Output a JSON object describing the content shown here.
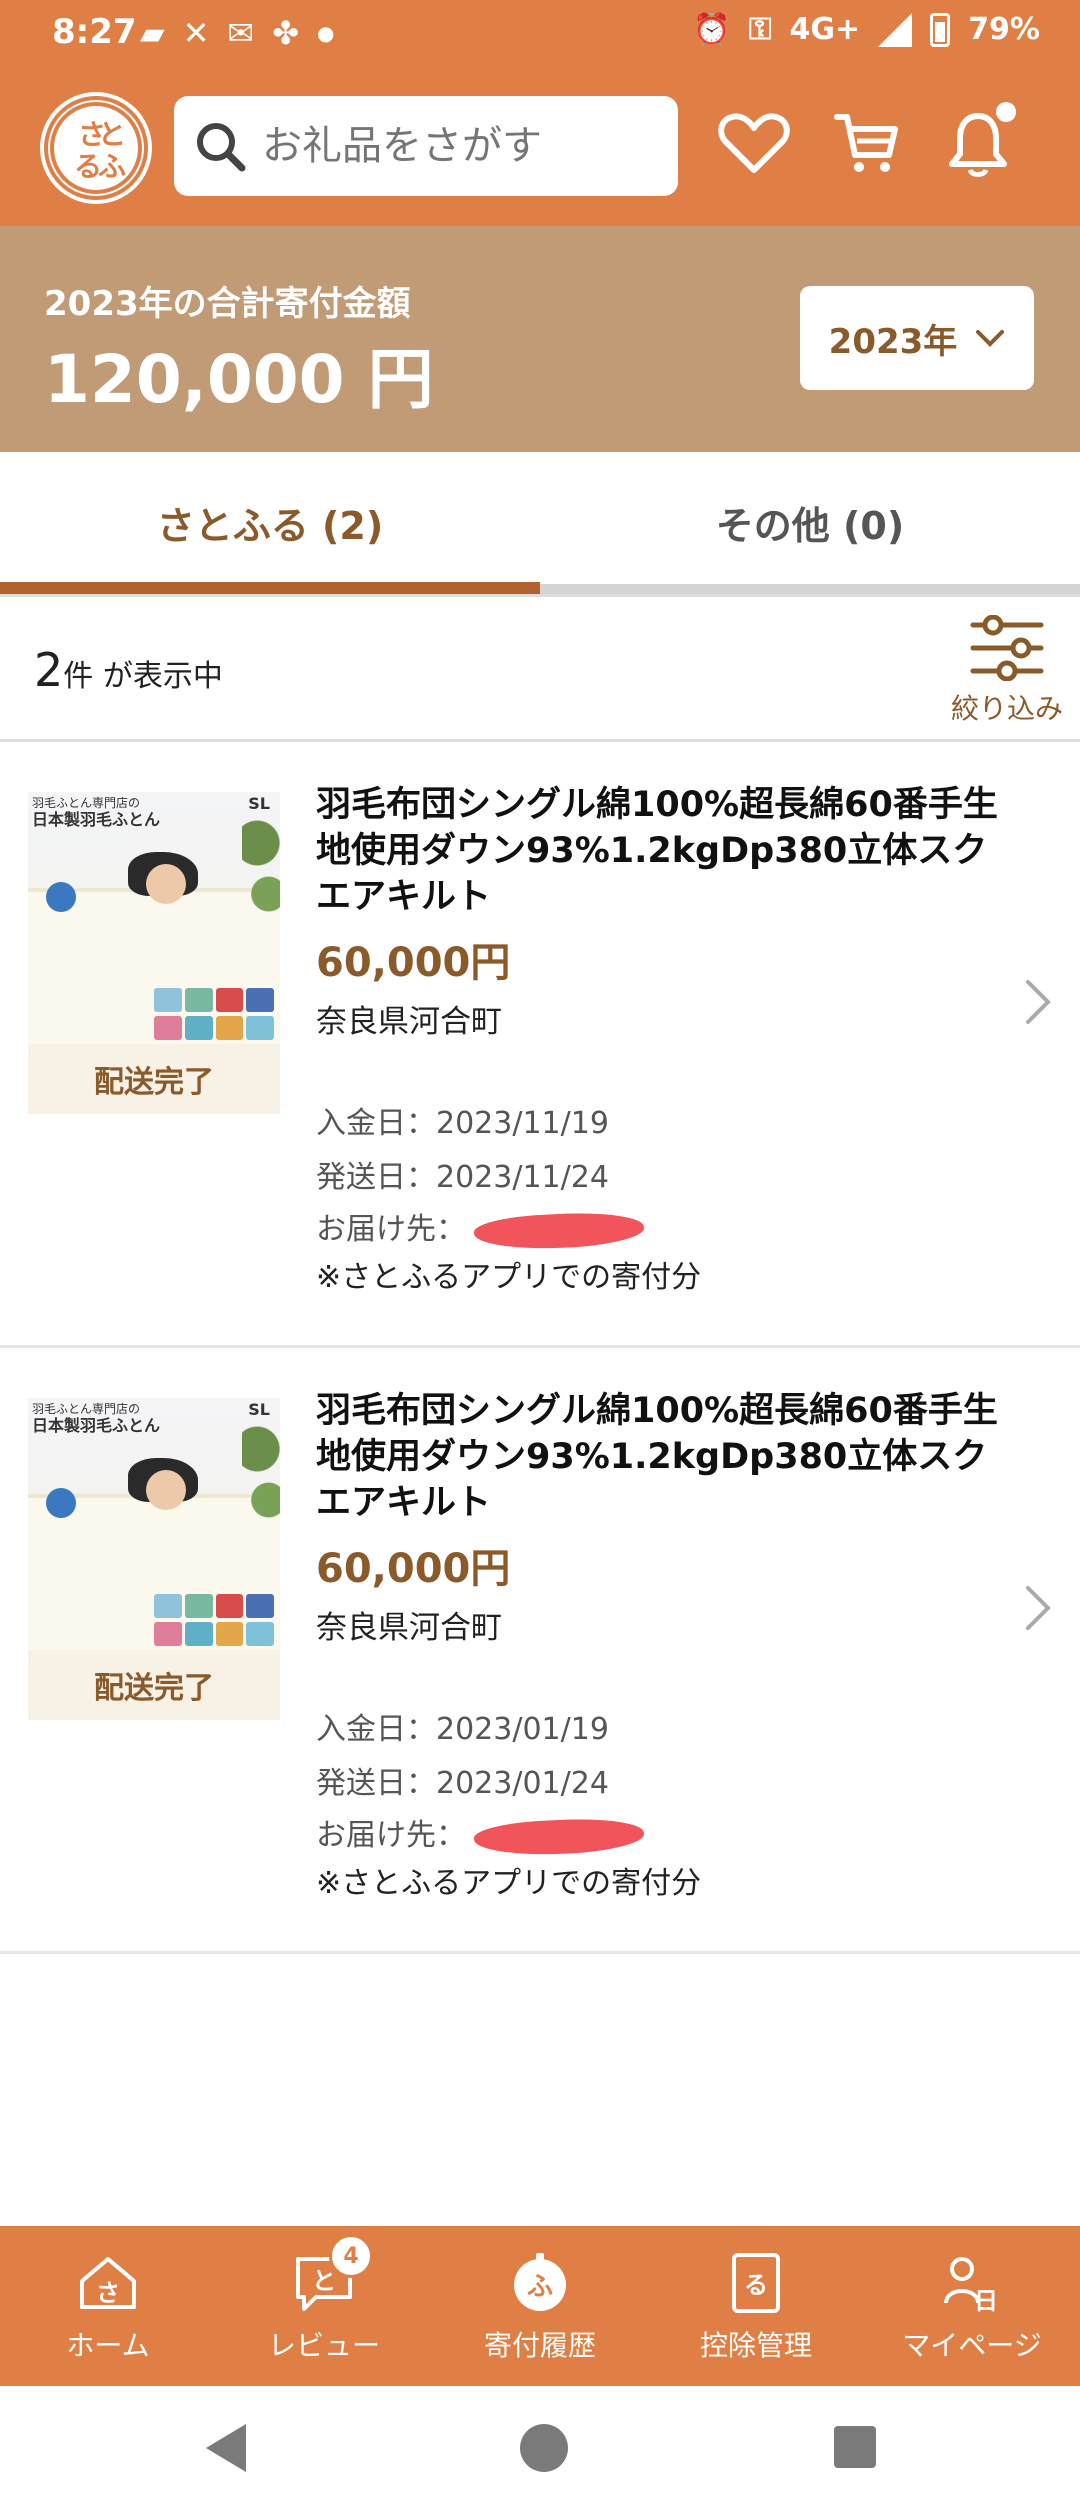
{
  "status_bar": {
    "time": "8:27",
    "network": "4G+",
    "battery": "79%"
  },
  "header": {
    "logo_text": "さとふる",
    "search_placeholder": "お礼品をさがす",
    "icons": [
      "heart-icon",
      "cart-icon",
      "bell-icon"
    ]
  },
  "summary": {
    "label": "2023年の合計寄付金額",
    "amount": "120,000 円",
    "year_select": "2023年"
  },
  "tabs": [
    {
      "label": "さとふる (2)",
      "active": true
    },
    {
      "label": "その他 (0)",
      "active": false
    }
  ],
  "list_header": {
    "count_number": "2",
    "count_suffix": "件 が表示中",
    "filter_label": "絞り込み"
  },
  "items": [
    {
      "status": "配送完了",
      "thumb_tagline_small": "羽毛ふとん専門店の",
      "thumb_tagline": "日本製羽毛ふとん",
      "thumb_size": "SL",
      "title": "羽毛布団シングル綿100%超長綿60番手生地使用ダウン93%1.2kgDp380立体スクエアキルト",
      "price": "60,000円",
      "region": "奈良県河合町",
      "paid_date": "入金日：2023/11/19",
      "ship_date": "発送日：2023/11/24",
      "delivery": "お届け先：",
      "note": "※さとふるアプリでの寄付分"
    },
    {
      "status": "配送完了",
      "thumb_tagline_small": "羽毛ふとん専門店の",
      "thumb_tagline": "日本製羽毛ふとん",
      "thumb_size": "SL",
      "title": "羽毛布団シングル綿100%超長綿60番手生地使用ダウン93%1.2kgDp380立体スクエアキルト",
      "price": "60,000円",
      "region": "奈良県河合町",
      "paid_date": "入金日：2023/01/19",
      "ship_date": "発送日：2023/01/24",
      "delivery": "お届け先：",
      "note": "※さとふるアプリでの寄付分"
    }
  ],
  "bottom_nav": [
    {
      "label": "ホーム",
      "icon": "home-icon",
      "glyph": "さ"
    },
    {
      "label": "レビュー",
      "icon": "review-icon",
      "glyph": "と",
      "badge": "4"
    },
    {
      "label": "寄付履歴",
      "icon": "history-icon",
      "glyph": "ふ",
      "active": true
    },
    {
      "label": "控除管理",
      "icon": "deduction-icon",
      "glyph": "る"
    },
    {
      "label": "マイページ",
      "icon": "mypage-icon",
      "glyph": "日"
    }
  ],
  "colors": {
    "brand": "#E07F45",
    "summary_bg": "#C19A76",
    "accent_text": "#8A5A2B",
    "redaction": "#F2545B"
  }
}
